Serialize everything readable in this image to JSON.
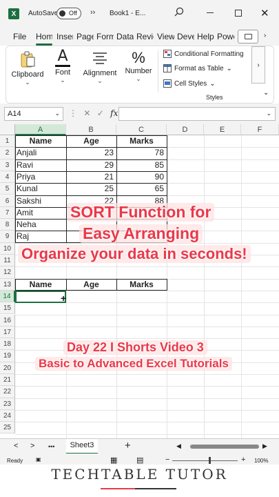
{
  "window": {
    "logo_letter": "X",
    "autosave_label": "AutoSave",
    "autosave_state": "Off",
    "more_label": "››",
    "doc_title": "Book1 - E...",
    "close_symbol": "✕"
  },
  "ribbon_tabs": [
    "File",
    "Home",
    "Insert",
    "Page",
    "Formulas",
    "Data",
    "Review",
    "View",
    "Developer",
    "Help",
    "Power"
  ],
  "ribbon": {
    "clipboard": "Clipboard",
    "font": "Font",
    "alignment": "Alignment",
    "number": "Number",
    "number_icon": "%",
    "font_icon": "A",
    "conditional_formatting": "Conditional Formatting",
    "format_as_table": "Format as Table",
    "cell_styles": "Cell Styles",
    "styles_group": "Styles",
    "dropdown_caret": "⌄",
    "scroll_right": "›",
    "collapse": "⌄"
  },
  "formula_bar": {
    "name_box": "A14",
    "fx": "fx",
    "cancel": "✕",
    "enter": "✓"
  },
  "columns": [
    "A",
    "B",
    "C",
    "D",
    "E",
    "F"
  ],
  "rows": [
    "1",
    "2",
    "3",
    "4",
    "5",
    "6",
    "7",
    "8",
    "9",
    "10",
    "11",
    "12",
    "13",
    "14",
    "15",
    "16",
    "17",
    "18",
    "19",
    "20",
    "21",
    "22",
    "23",
    "24",
    "25"
  ],
  "table": {
    "headers": [
      "Name",
      "Age",
      "Marks"
    ],
    "data": [
      [
        "Anjali",
        "23",
        "78"
      ],
      [
        "Ravi",
        "29",
        "85"
      ],
      [
        "Priya",
        "21",
        "90"
      ],
      [
        "Kunal",
        "25",
        "65"
      ],
      [
        "Sakshi",
        "22",
        "88"
      ],
      [
        "Amit",
        "",
        ""
      ],
      [
        "Neha",
        "",
        ""
      ],
      [
        "Raj",
        "",
        ""
      ]
    ],
    "result_headers": [
      "Name",
      "Age",
      "Marks"
    ]
  },
  "captions": {
    "line1": "SORT Function for",
    "line2": "Easy Arranging",
    "line3": "Organize your data in seconds!",
    "line4": "Day 22 I Shorts Video 3",
    "line5": "Basic to Advanced Excel Tutorials"
  },
  "sheets": {
    "active": "Sheet3",
    "prev": "<",
    "next": ">",
    "more": "•••",
    "add": "+"
  },
  "status": {
    "ready": "Ready",
    "zoom_minus": "−",
    "zoom_plus": "+",
    "zoom": "100%"
  },
  "brand": "TECHTABLE TUTOR",
  "colors": {
    "excel_green": "#1d6f42",
    "caption_red": "#e8394a"
  }
}
